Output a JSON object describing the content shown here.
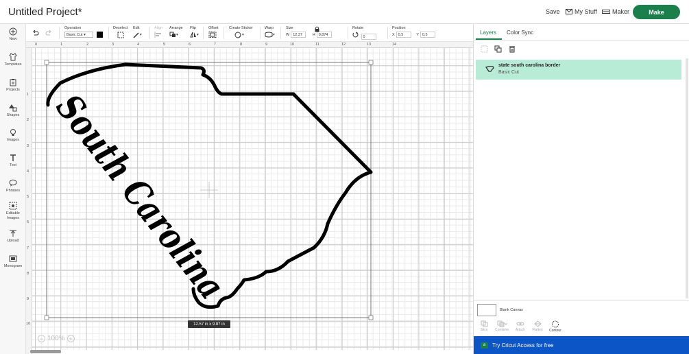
{
  "topbar": {
    "title": "Untitled Project*",
    "save_label": "Save",
    "my_stuff_label": "My Stuff",
    "maker_label": "Maker",
    "make_label": "Make",
    "make_color": "#1a7f4b"
  },
  "sidebar": {
    "items": [
      {
        "label": "New",
        "icon": "plus-circle-icon"
      },
      {
        "label": "Templates",
        "icon": "shirt-icon"
      },
      {
        "label": "Projects",
        "icon": "clipboard-icon"
      },
      {
        "label": "Shapes",
        "icon": "shapes-icon"
      },
      {
        "label": "Images",
        "icon": "bulb-icon"
      },
      {
        "label": "Text",
        "icon": "text-icon"
      },
      {
        "label": "Phrases",
        "icon": "speech-bubble-icon"
      },
      {
        "label": "Editable Images",
        "icon": "editable-image-icon"
      },
      {
        "label": "Upload",
        "icon": "upload-icon"
      },
      {
        "label": "Monogram",
        "icon": "monogram-icon"
      }
    ]
  },
  "toolbar": {
    "operation_label": "Operation",
    "operation_value": "Basic Cut",
    "deselect_label": "Deselect",
    "edit_label": "Edit",
    "align_label": "Align",
    "arrange_label": "Arrange",
    "flip_label": "Flip",
    "offset_label": "Offset",
    "create_sticker_label": "Create Sticker",
    "warp_label": "Warp",
    "size_label": "Size",
    "w_label": "W",
    "w_value": "12,37",
    "h_label": "H",
    "h_value": "9,874",
    "rotate_label": "Rotate",
    "rotate_value": "0",
    "position_label": "Position",
    "x_label": "X",
    "x_value": "0,5",
    "y_label": "Y",
    "y_value": "0,5"
  },
  "canvas": {
    "ruler_top": [
      "0",
      "1",
      "2",
      "3",
      "4",
      "5",
      "6",
      "7",
      "8",
      "9",
      "10",
      "11",
      "12",
      "13",
      "14"
    ],
    "ruler_left": [
      "1",
      "2",
      "3",
      "4",
      "5",
      "6",
      "7",
      "8",
      "9",
      "10"
    ],
    "dimension_label": "12.57  in x 9.87  in",
    "zoom_value": "100%",
    "design_text": "South Carolina"
  },
  "right_panel": {
    "tab_layers": "Layers",
    "tab_color_sync": "Color Sync",
    "layer_name": "state south carolina border",
    "layer_operation": "Basic Cut",
    "layer_bg_color": "#b9ecd6",
    "blank_canvas_label": "Blank Canvas",
    "bottom_tools": [
      "Slice",
      "Combine",
      "Attach",
      "Flatten",
      "Contour"
    ],
    "access_label": "Try Cricut Access for free",
    "access_color": "#0b55c7"
  }
}
